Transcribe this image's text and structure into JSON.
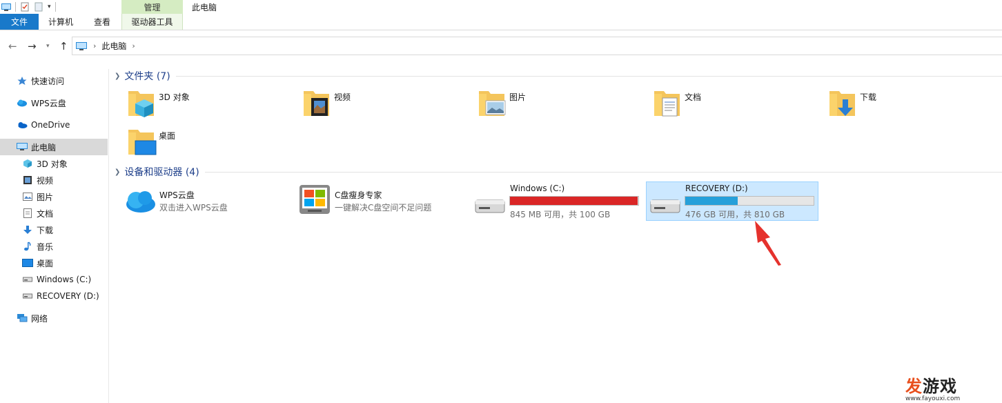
{
  "ribbon": {
    "context_band": "管理",
    "window_title": "此电脑",
    "tabs": {
      "file": "文件",
      "computer": "计算机",
      "view": "查看",
      "drive_tools": "驱动器工具"
    }
  },
  "address": {
    "location": "此电脑"
  },
  "sidebar": {
    "quick_access": "快速访问",
    "wps_cloud": "WPS云盘",
    "onedrive": "OneDrive",
    "this_pc": "此电脑",
    "objects3d": "3D 对象",
    "videos": "视频",
    "pictures": "图片",
    "documents": "文档",
    "downloads": "下载",
    "music": "音乐",
    "desktop": "桌面",
    "drive_c": "Windows (C:)",
    "drive_d": "RECOVERY (D:)",
    "network": "网络"
  },
  "folders_group": {
    "title": "文件夹 (7)",
    "items": [
      "3D 对象",
      "视频",
      "图片",
      "文档",
      "下载",
      "桌面"
    ]
  },
  "devices_group": {
    "title": "设备和驱动器 (4)",
    "wps": {
      "name": "WPS云盘",
      "desc": "双击进入WPS云盘"
    },
    "cleaner": {
      "name": "C盘瘦身专家",
      "desc": "一键解决C盘空间不足问题"
    },
    "drive_c": {
      "name": "Windows (C:)",
      "free": "845 MB 可用，共 100 GB",
      "used_fraction": 0.992,
      "bar_color": "#da2626"
    },
    "drive_d": {
      "name": "RECOVERY (D:)",
      "free": "476 GB 可用，共 810 GB",
      "used_fraction": 0.41,
      "bar_color": "#26a0da"
    }
  },
  "watermark": {
    "brand_a": "发",
    "brand_b": "游戏",
    "url": "www.fayouxi.com"
  }
}
